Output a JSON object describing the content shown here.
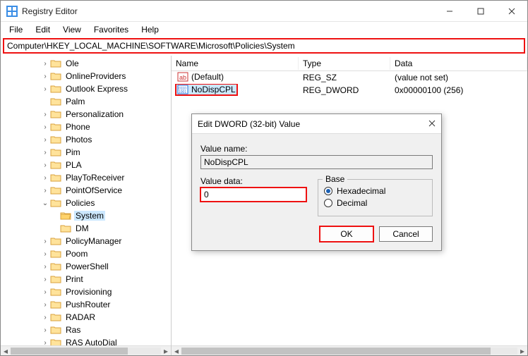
{
  "window": {
    "title": "Registry Editor",
    "minimize_tooltip": "Minimize",
    "maximize_tooltip": "Maximize",
    "close_tooltip": "Close"
  },
  "menu": {
    "items": [
      "File",
      "Edit",
      "View",
      "Favorites",
      "Help"
    ]
  },
  "address": {
    "value": "Computer\\HKEY_LOCAL_MACHINE\\SOFTWARE\\Microsoft\\Policies\\System"
  },
  "tree": {
    "nodes": [
      {
        "indent": 4,
        "exp": ">",
        "label": "Ole"
      },
      {
        "indent": 4,
        "exp": ">",
        "label": "OnlineProviders"
      },
      {
        "indent": 4,
        "exp": ">",
        "label": "Outlook Express"
      },
      {
        "indent": 4,
        "exp": "",
        "label": "Palm"
      },
      {
        "indent": 4,
        "exp": ">",
        "label": "Personalization"
      },
      {
        "indent": 4,
        "exp": ">",
        "label": "Phone"
      },
      {
        "indent": 4,
        "exp": ">",
        "label": "Photos"
      },
      {
        "indent": 4,
        "exp": ">",
        "label": "Pim"
      },
      {
        "indent": 4,
        "exp": ">",
        "label": "PLA"
      },
      {
        "indent": 4,
        "exp": ">",
        "label": "PlayToReceiver"
      },
      {
        "indent": 4,
        "exp": ">",
        "label": "PointOfService"
      },
      {
        "indent": 4,
        "exp": "v",
        "label": "Policies"
      },
      {
        "indent": 5,
        "exp": "",
        "label": "System",
        "selected": true,
        "open": true
      },
      {
        "indent": 5,
        "exp": "",
        "label": "DM"
      },
      {
        "indent": 4,
        "exp": ">",
        "label": "PolicyManager"
      },
      {
        "indent": 4,
        "exp": ">",
        "label": "Poom"
      },
      {
        "indent": 4,
        "exp": ">",
        "label": "PowerShell"
      },
      {
        "indent": 4,
        "exp": ">",
        "label": "Print"
      },
      {
        "indent": 4,
        "exp": ">",
        "label": "Provisioning"
      },
      {
        "indent": 4,
        "exp": ">",
        "label": "PushRouter"
      },
      {
        "indent": 4,
        "exp": ">",
        "label": "RADAR"
      },
      {
        "indent": 4,
        "exp": ">",
        "label": "Ras"
      },
      {
        "indent": 4,
        "exp": ">",
        "label": "RAS AutoDial"
      }
    ]
  },
  "list": {
    "columns": {
      "name": "Name",
      "type": "Type",
      "data": "Data"
    },
    "rows": [
      {
        "icon": "ab",
        "name": "(Default)",
        "type": "REG_SZ",
        "data": "(value not set)"
      },
      {
        "icon": "bin",
        "name": "NoDispCPL",
        "type": "REG_DWORD",
        "data": "0x00000100 (256)",
        "highlight": true,
        "selected": true
      }
    ]
  },
  "dialog": {
    "title": "Edit DWORD (32-bit) Value",
    "value_name_label": "Value name:",
    "value_name": "NoDispCPL",
    "value_data_label": "Value data:",
    "value_data": "0",
    "base_label": "Base",
    "hex_label": "Hexadecimal",
    "dec_label": "Decimal",
    "base_selected": "hex",
    "ok": "OK",
    "cancel": "Cancel"
  }
}
